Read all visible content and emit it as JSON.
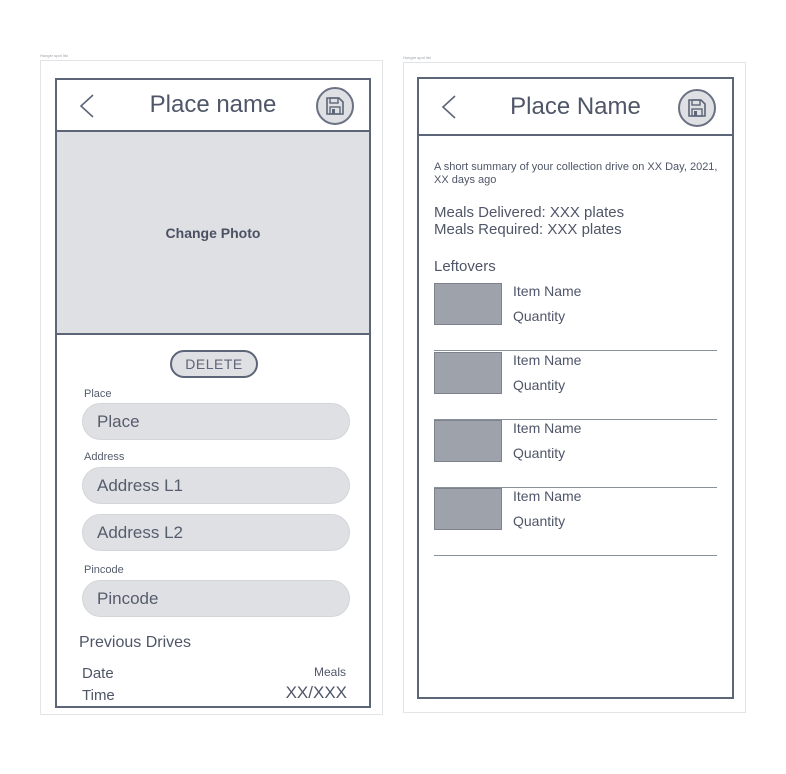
{
  "frames": [
    {
      "label": "Hunger spot list",
      "header": {
        "title": "Place name",
        "back_icon": "chevron-left-icon",
        "save_icon": "floppy-disk-icon"
      },
      "photo": {
        "label": "Change Photo"
      },
      "delete_label": "DELETE",
      "fields": {
        "place_label": "Place",
        "place_placeholder": "Place",
        "address_label": "Address",
        "address1_placeholder": "Address L1",
        "address2_placeholder": "Address L2",
        "pincode_label": "Pincode",
        "pincode_placeholder": "Pincode"
      },
      "previous_drives": {
        "title": "Previous Drives",
        "date_label": "Date",
        "time_label": "Time",
        "meals_label": "Meals",
        "meals_value": "XX/XXX"
      }
    },
    {
      "label": "Hunger spot list",
      "header": {
        "title": "Place Name",
        "back_icon": "chevron-left-icon",
        "save_icon": "floppy-disk-icon"
      },
      "summary": "A short summary of your collection drive on XX Day, 2021, XX days ago",
      "meals_delivered": "Meals Delivered: XXX plates",
      "meals_required": "Meals Required: XXX plates",
      "leftovers_title": "Leftovers",
      "leftovers": [
        {
          "name": "Item Name",
          "quantity": "Quantity"
        },
        {
          "name": "Item Name",
          "quantity": "Quantity"
        },
        {
          "name": "Item Name",
          "quantity": "Quantity"
        },
        {
          "name": "Item Name",
          "quantity": "Quantity"
        }
      ]
    }
  ],
  "colors": {
    "stroke": "#5d6578",
    "fill": "#dfe0e3",
    "thumb": "#9ea2ab",
    "text": "#4f5668"
  }
}
